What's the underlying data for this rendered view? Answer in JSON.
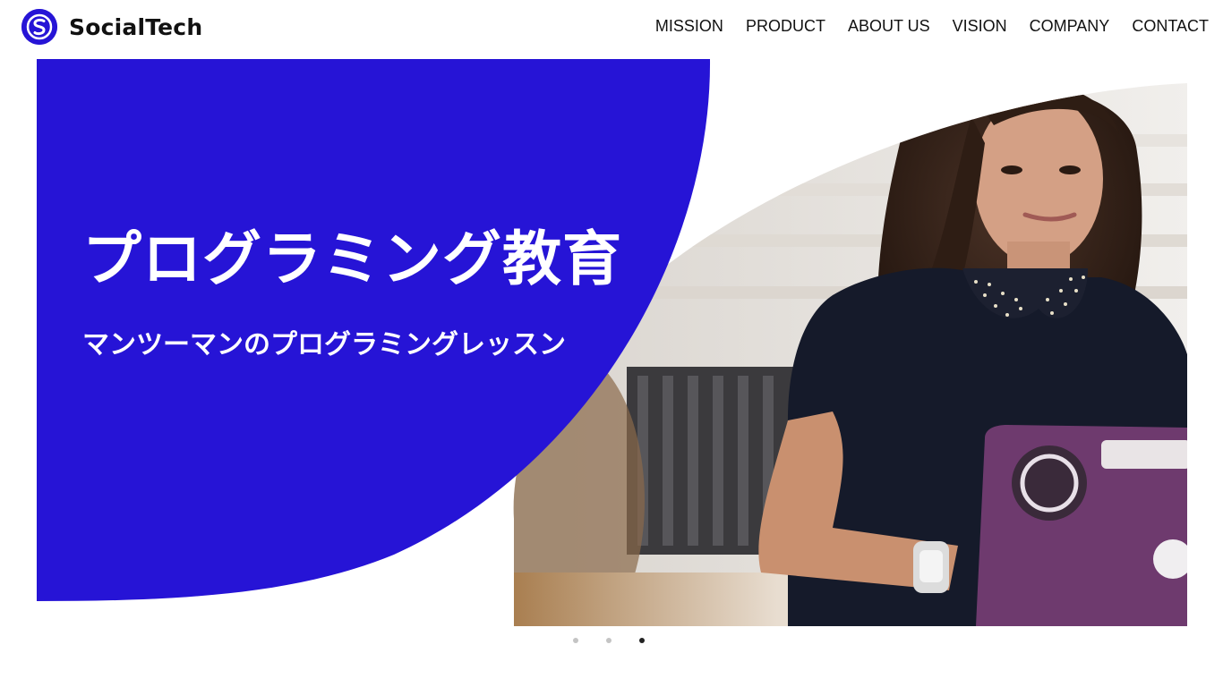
{
  "brand": {
    "name": "SocialTech",
    "color": "#2614d6",
    "logo_icon": "s-logo-icon"
  },
  "nav": {
    "items": [
      {
        "label": "MISSION"
      },
      {
        "label": "PRODUCT"
      },
      {
        "label": "ABOUT US"
      },
      {
        "label": "VISION"
      },
      {
        "label": "COMPANY"
      },
      {
        "label": "CONTACT"
      }
    ]
  },
  "hero": {
    "headline": "プログラミング教育",
    "subline": "マンツーマンのプログラミングレッスン",
    "image": "woman-with-laptop-photo",
    "panel_color": "#2614d6"
  },
  "carousel": {
    "slide_count": 3,
    "active_index": 2
  }
}
